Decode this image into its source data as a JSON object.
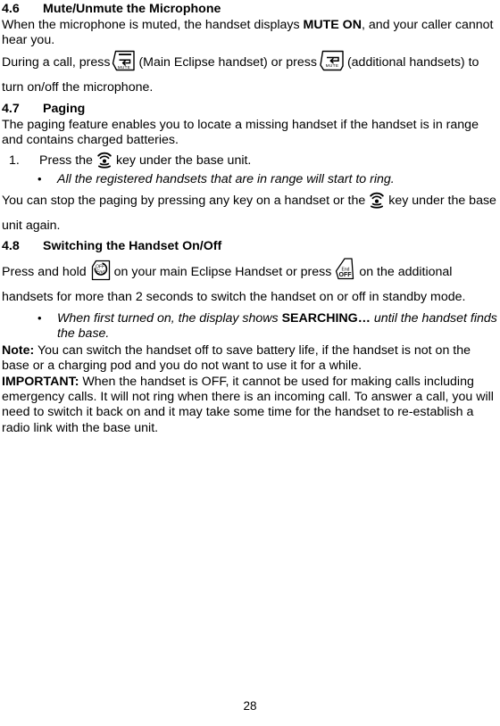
{
  "document": {
    "page_number": "28"
  },
  "sections": {
    "mute": {
      "number": "4.6",
      "title": "Mute/Unmute the Microphone",
      "para1_a": "When the microphone is muted, the handset displays ",
      "para1_bold": "MUTE ON",
      "para1_b": ", and your caller cannot hear you.",
      "para2_a": "During a call, press",
      "para2_b": "(Main Eclipse handset) or press",
      "para2_c": "(additional handsets) to turn on/off the microphone.",
      "icon_main_label": "MUTE",
      "icon_additional_label": "MUTE"
    },
    "paging": {
      "number": "4.7",
      "title": "Paging",
      "para1": "The paging feature enables you to locate a missing handset if the handset is in range and contains charged batteries.",
      "step1_index": "1.",
      "step1_a": "Press the",
      "step1_b": "key under the base unit.",
      "bullet1": "All the registered handsets that are in range will start to ring.",
      "para2_a": "You can stop the paging by pressing any key on a handset or the",
      "para2_b": "key under the base unit again."
    },
    "switching": {
      "number": "4.8",
      "title": "Switching the Handset On/Off",
      "para1_a": "Press and hold",
      "para1_b": "on your main Eclipse Handset or press",
      "para1_c": "on the additional handsets for more than 2 seconds to switch the handset on or off in standby mode.",
      "icon_main_line1": "OFF",
      "icon_main_line2": "End",
      "icon_additional_line1": "End",
      "icon_additional_line2": "OFF",
      "bullet1_a": "When first turned on, the display shows ",
      "bullet1_bold": "SEARCHING…",
      "bullet1_b": " until the handset finds the base.",
      "note_label": "Note:",
      "note_text": " You can switch the handset off to save battery life, if the handset is not on the base or a charging pod and you do not want to use it for a while.",
      "important_label": "IMPORTANT:",
      "important_text": " When the handset is OFF, it cannot be used for making calls including emergency calls. It will not ring when there is an incoming call. To answer a call, you will need to switch it back on and it may take some time for the handset to re-establish a radio link with the base unit."
    }
  },
  "icons": {
    "mute_key": "mute-key-icon",
    "paging_key": "paging-key-icon",
    "power_key": "power-off-key-icon"
  }
}
